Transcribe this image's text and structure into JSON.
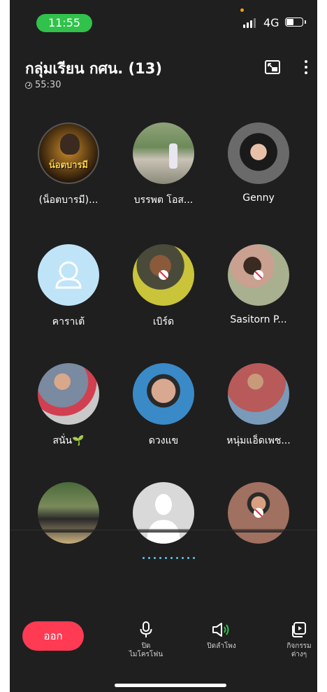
{
  "status_bar": {
    "time": "11:55",
    "network": "4G"
  },
  "header": {
    "title": "กลุ่มเรียน กศน. (13)",
    "duration": "55:30"
  },
  "participants": [
    {
      "name": "(น็อตบารมี)...",
      "avatar_text": "น็อตบารมี",
      "avatar_color": "#3a2a1a",
      "muted": false
    },
    {
      "name": "บรรพต โอส...",
      "avatar_color": "#6d8a5a",
      "muted": false
    },
    {
      "name": "Genny",
      "avatar_color": "#4a4a4a",
      "muted": false
    },
    {
      "name": "คาราเต้",
      "avatar_color": "#bfe4f7",
      "muted": false,
      "placeholder": true
    },
    {
      "name": "เบิร์ด",
      "avatar_color": "#6b6b5a",
      "muted": true
    },
    {
      "name": "Sasitorn P...",
      "avatar_color": "#8a7a6a",
      "muted": true
    },
    {
      "name": "สนั่น🌱",
      "avatar_color": "#8a8a9a",
      "muted": false
    },
    {
      "name": "ดวงแข",
      "avatar_color": "#b98c7a",
      "muted": false
    },
    {
      "name": "หนุ่มแอ็ดเพช...",
      "avatar_color": "#9a6a6a",
      "muted": false
    },
    {
      "name": "",
      "avatar_color": "#5a6a3a",
      "muted": false
    },
    {
      "name": "",
      "avatar_color": "#d9d9d9",
      "muted": false,
      "placeholder_grey": true
    },
    {
      "name": "",
      "avatar_color": "#9a6a5a",
      "muted": true
    }
  ],
  "controls": {
    "leave": "ออก",
    "mic": "ปิด\nไมโครโฟน",
    "speaker": "ปิดลำโพง",
    "activity": "กิจกรรม\nต่างๆ"
  },
  "colors": {
    "accent": "#30c24a",
    "leave": "#ff3b54",
    "pager": "#5ec8ef",
    "background": "#1f1f1f"
  }
}
